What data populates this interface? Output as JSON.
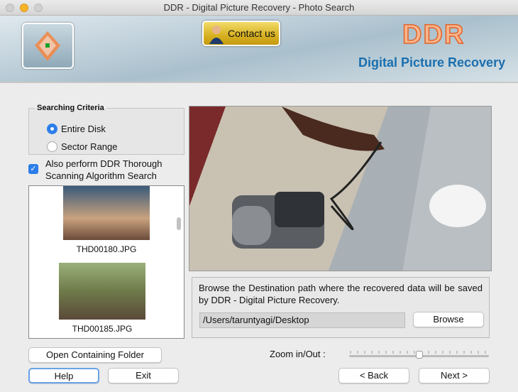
{
  "window": {
    "title": "DDR - Digital Picture Recovery - Photo Search"
  },
  "banner": {
    "contact_label": "Contact us",
    "brand": "DDR",
    "product": "Digital Picture Recovery"
  },
  "criteria": {
    "legend": "Searching Criteria",
    "options": [
      {
        "label": "Entire Disk",
        "selected": true
      },
      {
        "label": "Sector Range",
        "selected": false
      }
    ]
  },
  "thorough": {
    "label": "Also perform DDR Thorough Scanning Algorithm Search",
    "checked": true
  },
  "thumbnails": [
    {
      "name": "THD00180.JPG"
    },
    {
      "name": "THD00185.JPG"
    }
  ],
  "destination": {
    "text": "Browse the Destination path where the recovered data will be saved by DDR - Digital Picture Recovery.",
    "path": "/Users/taruntyagi/Desktop",
    "browse_label": "Browse"
  },
  "zoom": {
    "label": "Zoom in/Out :",
    "value": 0.5
  },
  "buttons": {
    "open_folder": "Open Containing Folder",
    "help": "Help",
    "exit": "Exit",
    "back": "< Back",
    "next": "Next >"
  }
}
